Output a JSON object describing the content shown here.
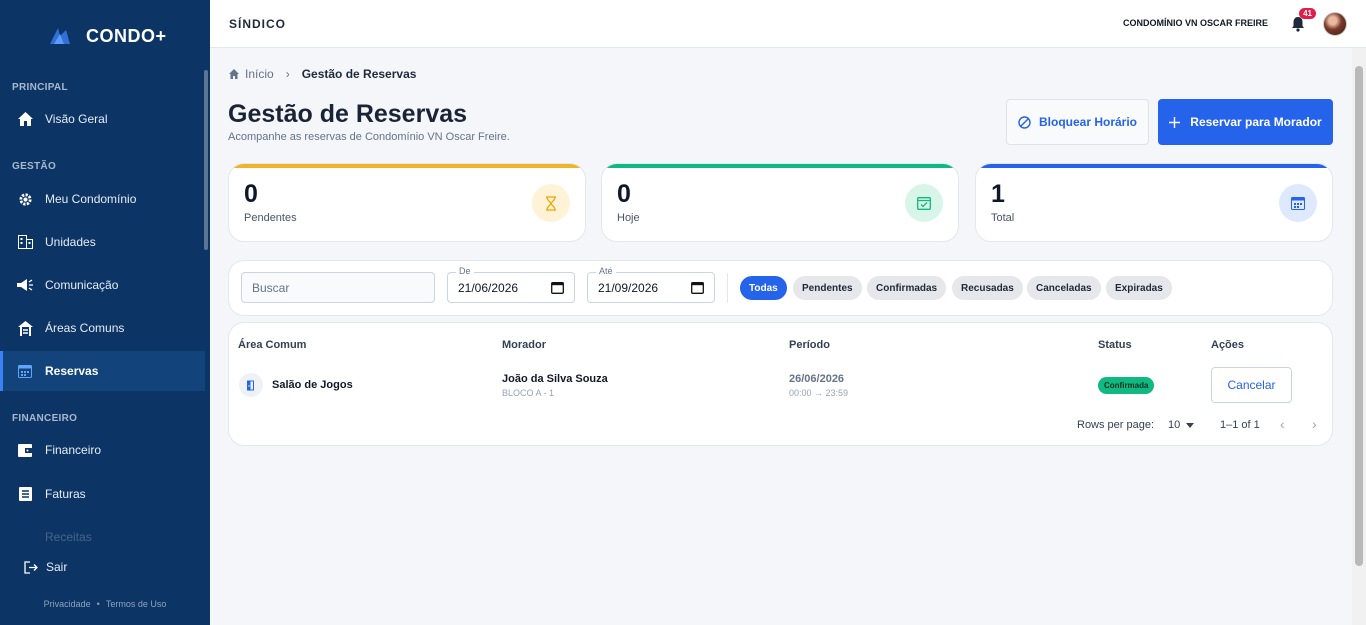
{
  "sidebar": {
    "brand": "CONDO+",
    "sections": {
      "principal": "PRINCIPAL",
      "gestao": "GESTÃO",
      "financeiro": "FINANCEIRO"
    },
    "items": {
      "visao_geral": "Visão Geral",
      "meu_condominio": "Meu Condomínio",
      "unidades": "Unidades",
      "comunicacao": "Comunicação",
      "areas_comuns": "Áreas Comuns",
      "reservas": "Reservas",
      "financeiro": "Financeiro",
      "faturas": "Faturas",
      "receitas": "Receitas"
    },
    "active": "reservas",
    "logout": "Sair",
    "privacy": "Privacidade",
    "terms": "Termos de Uso"
  },
  "topbar": {
    "role": "SÍNDICO",
    "condo_name": "CONDOMÍNIO VN OSCAR FREIRE",
    "notification_count": "41"
  },
  "breadcrumb": {
    "home": "Início",
    "current": "Gestão de Reservas"
  },
  "page": {
    "title": "Gestão de Reservas",
    "subtitle": "Acompanhe as reservas de Condomínio VN Oscar Freire.",
    "block_button": "Bloquear Horário",
    "reserve_button": "Reservar para Morador"
  },
  "stats": [
    {
      "value": "0",
      "label": "Pendentes",
      "color": "#f0b429",
      "icon": "hourglass-icon"
    },
    {
      "value": "0",
      "label": "Hoje",
      "color": "#10b981",
      "icon": "calendar-check-icon"
    },
    {
      "value": "1",
      "label": "Total",
      "color": "#2563eb",
      "icon": "calendar-icon"
    }
  ],
  "filters": {
    "search_placeholder": "Buscar",
    "from_label": "De",
    "from_value": "21/06/2026",
    "to_label": "Até",
    "to_value": "21/09/2026",
    "chips": [
      "Todas",
      "Pendentes",
      "Confirmadas",
      "Recusadas",
      "Canceladas",
      "Expiradas"
    ],
    "active_chip": "Todas"
  },
  "table": {
    "headers": [
      "Área Comum",
      "Morador",
      "Período",
      "Status",
      "Ações"
    ],
    "rows": [
      {
        "area": "Salão de Jogos",
        "resident": "João da Silva Souza",
        "unit": "BLOCO A - 1",
        "date": "26/06/2026",
        "time": "00:00 → 23:59",
        "status": "Confirmada",
        "action": "Cancelar"
      }
    ],
    "rows_per_page_label": "Rows per page:",
    "rows_per_page": "10",
    "range": "1–1 of 1"
  },
  "colors": {
    "sidebar_bg": "#0c3566",
    "primary": "#2563eb",
    "success": "#10b981",
    "warning": "#f0b429"
  }
}
